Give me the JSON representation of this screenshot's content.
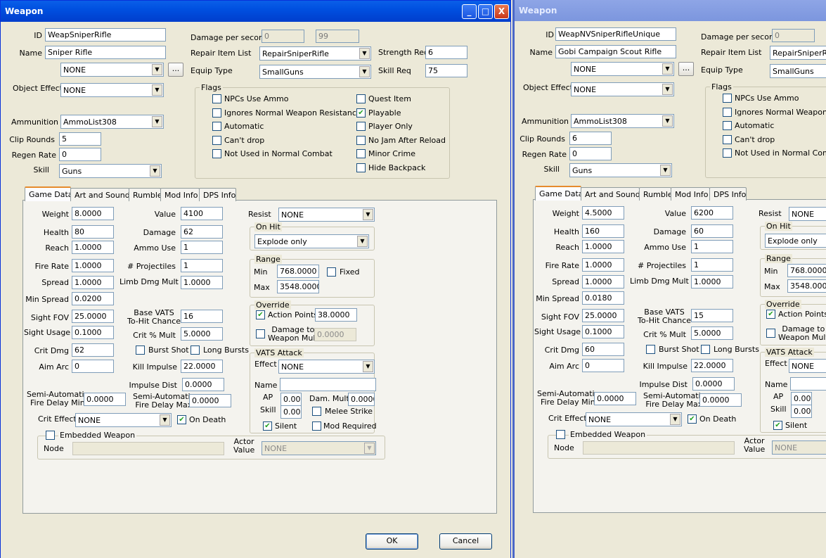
{
  "left": {
    "title": "Weapon",
    "id": "WeapSniperRifle",
    "name": "Sniper Rifle",
    "script": "NONE",
    "script_btn": "...",
    "object_effect": "NONE",
    "dps": "0",
    "dps2": "99",
    "repair_list": "RepairSniperRifle",
    "equip_type": "SmallGuns",
    "strength_req": "6",
    "skill_req": "75",
    "ammunition": "AmmoList308",
    "clip_rounds": "5",
    "regen_rate": "0",
    "skill": "Guns",
    "weight": "8.0000",
    "health": "80",
    "reach": "1.0000",
    "fire_rate": "1.0000",
    "spread": "1.0000",
    "min_spread": "0.0200",
    "sight_fov": "25.0000",
    "sight_usage": "0.1000",
    "crit_dmg": "62",
    "aim_arc": "0",
    "semi_min": "0.0000",
    "value": "4100",
    "damage": "62",
    "ammo_use": "1",
    "projectiles": "1",
    "limb_mult": "1.0000",
    "vats_chance": "16",
    "crit_mult": "5.0000",
    "kill_impulse": "22.0000",
    "impulse_dist": "0.0000",
    "semi_max": "0.0000",
    "crit_effect": "NONE",
    "resist": "NONE",
    "on_hit": "Explode only",
    "range_min": "768.0000",
    "range_max": "3548.0000",
    "action_points": "38.0000",
    "dmg_weapon_mult": "0.0000",
    "vats_effect": "NONE",
    "vats_name": "",
    "vats_ap": "0.00",
    "vats_dam_mult": "0.0000",
    "vats_skill": "0.00",
    "actor_value": "NONE",
    "node": ""
  },
  "right": {
    "title": "Weapon",
    "id": "WeapNVSniperRifleUnique",
    "name": "Gobi Campaign Scout Rifle",
    "script": "NONE",
    "script_btn": "...",
    "object_effect": "NONE",
    "dps": "0",
    "repair_list": "RepairSniperRif",
    "equip_type": "SmallGuns",
    "ammunition": "AmmoList308",
    "clip_rounds": "6",
    "regen_rate": "0",
    "skill": "Guns",
    "weight": "4.5000",
    "health": "160",
    "reach": "1.0000",
    "fire_rate": "1.0000",
    "spread": "1.0000",
    "min_spread": "0.0180",
    "sight_fov": "25.0000",
    "sight_usage": "0.1000",
    "crit_dmg": "60",
    "aim_arc": "0",
    "semi_min": "0.0000",
    "value": "6200",
    "damage": "60",
    "ammo_use": "1",
    "projectiles": "1",
    "limb_mult": "1.0000",
    "vats_chance": "15",
    "crit_mult": "5.0000",
    "kill_impulse": "22.0000",
    "impulse_dist": "0.0000",
    "semi_max": "0.0000",
    "crit_effect": "NONE",
    "resist": "NONE",
    "on_hit": "Explode only",
    "range_min": "768.0000",
    "range_max": "3548.0000",
    "vats_effect": "NONE",
    "vats_ap": "0.00",
    "vats_skill": "0.00",
    "actor_value": "NONE"
  },
  "labels": {
    "id": "ID",
    "name": "Name",
    "object_effect": "Object Effect",
    "dps": "Damage per second",
    "repair_list": "Repair Item List",
    "equip_type": "Equip Type",
    "strength_req": "Strength Req",
    "skill_req": "Skill Req",
    "flags": "Flags",
    "ammunition": "Ammunition",
    "clip_rounds": "Clip Rounds",
    "regen_rate": "Regen Rate",
    "skill": "Skill",
    "weight": "Weight",
    "health": "Health",
    "reach": "Reach",
    "fire_rate": "Fire Rate",
    "spread": "Spread",
    "min_spread": "Min Spread",
    "sight_fov": "Sight FOV",
    "sight_usage": "Sight Usage",
    "crit_dmg": "Crit Dmg",
    "aim_arc": "Aim Arc",
    "semi_min_1": "Semi-Automatic",
    "semi_min_2": "Fire Delay Min",
    "crit_effect": "Crit Effect",
    "embedded": "Embedded Weapon",
    "node": "Node",
    "actor_1": "Actor",
    "actor_2": "Value",
    "value": "Value",
    "damage": "Damage",
    "ammo_use": "Ammo Use",
    "projectiles": "# Projectiles",
    "limb_mult": "Limb Dmg Mult",
    "vats_1": "Base VATS",
    "vats_2": "To-Hit Chance",
    "crit_mult": "Crit % Mult",
    "burst": "Burst Shot",
    "long_bursts": "Long Bursts",
    "kill_impulse": "Kill Impulse",
    "impulse_dist": "Impulse Dist",
    "semi_max_1": "Semi-Automatic",
    "semi_max_2": "Fire Delay Max",
    "on_death": "On Death",
    "resist": "Resist",
    "on_hit": "On Hit",
    "range": "Range",
    "min": "Min",
    "max": "Max",
    "fixed": "Fixed",
    "override": "Override",
    "action_points": "Action Points",
    "dmg_to_1": "Damage to",
    "dmg_to_2": "Weapon Mult",
    "vats_attack": "VATS Attack",
    "effect": "Effect",
    "vname": "Name",
    "ap": "AP",
    "dam_mult": "Dam. Mult",
    "vskill": "Skill",
    "melee": "Melee Strike",
    "silent": "Silent",
    "mod_required": "Mod Required",
    "ok": "OK",
    "cancel": "Cancel"
  },
  "flags": [
    "NPCs Use Ammo",
    "Ignores Normal Weapon Resistance",
    "Automatic",
    "Can't drop",
    "Not Used in Normal Combat",
    "Quest Item",
    "Playable",
    "Player Only",
    "No Jam After Reload",
    "Minor Crime",
    "Hide Backpack"
  ],
  "flags_right": [
    "NPCs Use Ammo",
    "Ignores Normal Weapon Re",
    "Automatic",
    "Can't drop",
    "Not Used in Normal Combat"
  ],
  "tabs": [
    "Game Data",
    "Art and Sound",
    "Rumble",
    "Mod Info",
    "DPS Info"
  ],
  "title_buttons": {
    "minimize": "_",
    "maximize": "□",
    "close": "X"
  },
  "checkbox_mark": "✔",
  "dropdown_arrow": "▼"
}
